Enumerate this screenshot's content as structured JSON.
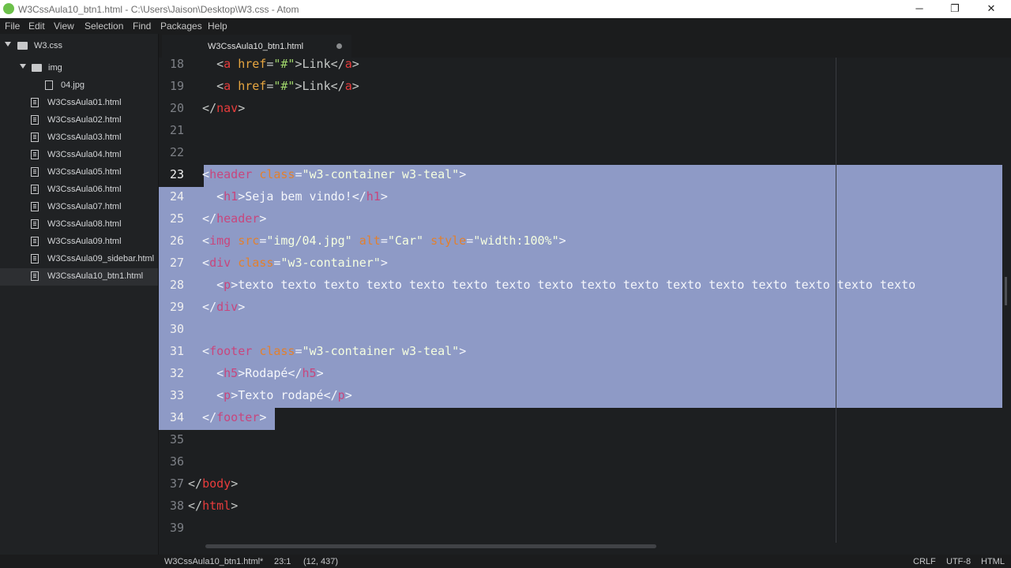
{
  "window": {
    "title": "W3CssAula10_btn1.html - C:\\Users\\Jaison\\Desktop\\W3.css - Atom",
    "minimize_glyph": "─",
    "maximize_glyph": "❐",
    "close_glyph": "✕"
  },
  "menu": [
    "File",
    "Edit",
    "View",
    "Selection",
    "Find",
    "Packages",
    "Help"
  ],
  "tree": {
    "root": "W3.css",
    "folder": "img",
    "folder_files": [
      "04.jpg"
    ],
    "files": [
      "W3CssAula01.html",
      "W3CssAula02.html",
      "W3CssAula03.html",
      "W3CssAula04.html",
      "W3CssAula05.html",
      "W3CssAula06.html",
      "W3CssAula07.html",
      "W3CssAula08.html",
      "W3CssAula09.html",
      "W3CssAula09_sidebar.html",
      "W3CssAula10_btn1.html"
    ],
    "selected_file": "W3CssAula10_btn1.html"
  },
  "tab": {
    "label": "W3CssAula10_btn1.html",
    "modified": true
  },
  "editor": {
    "line_numbers": [
      "18",
      "19",
      "20",
      "21",
      "22",
      "23",
      "24",
      "25",
      "26",
      "27",
      "28",
      "29",
      "30",
      "31",
      "32",
      "33",
      "34",
      "35",
      "36",
      "37",
      "38",
      "39"
    ],
    "selected_lines": [
      "23",
      "24",
      "25",
      "26",
      "27",
      "28",
      "29",
      "30",
      "31",
      "32",
      "33",
      "34"
    ],
    "code_lines": [
      "    <a href=\"#\">Link</a>",
      "    <a href=\"#\">Link</a>",
      "  </nav>",
      "",
      "",
      "  <header class=\"w3-container w3-teal\">",
      "    <h1>Seja bem vindo!</h1>",
      "  </header>",
      "  <img src=\"img/04.jpg\" alt=\"Car\" style=\"width:100%\">",
      "  <div class=\"w3-container\">",
      "    <p>texto texto texto texto texto texto texto texto texto texto texto texto texto texto texto texto",
      "  </div>",
      "",
      "  <footer class=\"w3-container w3-teal\">",
      "    <h5>Rodapé</h5>",
      "    <p>Texto rodapé</p>",
      "  </footer>",
      "",
      "",
      "</body>",
      "</html>",
      ""
    ]
  },
  "status": {
    "file": "W3CssAula10_btn1.html*",
    "cursor": "23:1",
    "selection": "(12, 437)",
    "line_ending": "CRLF",
    "encoding": "UTF-8",
    "grammar": "HTML"
  },
  "colors": {
    "background": "#1d1f21",
    "selection": "#8e9ac6",
    "tag": "#e83c3c",
    "attribute": "#e7a640",
    "string": "#9fd46a"
  }
}
